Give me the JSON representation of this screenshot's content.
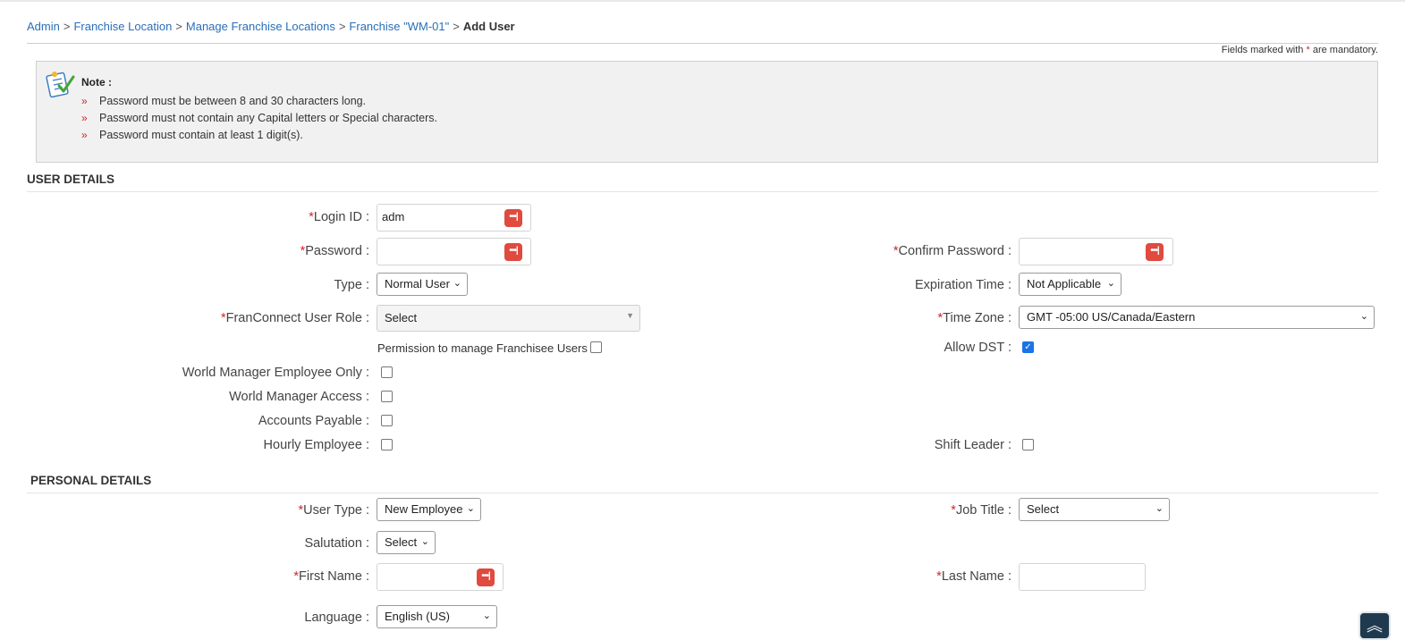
{
  "breadcrumb": {
    "items": [
      "Admin",
      "Franchise Location",
      "Manage Franchise Locations",
      "Franchise \"WM-01\""
    ],
    "current": "Add User",
    "separator": ">"
  },
  "mandatory": {
    "prefix": "Fields marked with",
    "star": "*",
    "suffix": "are mandatory."
  },
  "note": {
    "title": "Note :",
    "bullet": "»",
    "items": [
      "Password must be between 8 and 30 characters long.",
      "Password must not contain any Capital letters or Special characters.",
      "Password must contain at least 1 digit(s)."
    ]
  },
  "user_details": {
    "title": "USER DETAILS",
    "login_id": {
      "label": "Login ID :",
      "value": "adm"
    },
    "password": {
      "label": "Password :",
      "value": ""
    },
    "confirm_password": {
      "label": "Confirm Password :",
      "value": ""
    },
    "type": {
      "label": "Type :",
      "value": "Normal User"
    },
    "expiration_time": {
      "label": "Expiration Time :",
      "value": "Not Applicable"
    },
    "user_role": {
      "label": "FranConnect User Role :",
      "value": "Select"
    },
    "time_zone": {
      "label": "Time Zone :",
      "value": "GMT -05:00 US/Canada/Eastern"
    },
    "permission_label": "Permission to manage Franchisee Users",
    "allow_dst": {
      "label": "Allow DST :",
      "checked": true
    },
    "wm_employee_only": "World Manager Employee Only :",
    "wm_access": "World Manager Access :",
    "accounts_payable": "Accounts Payable :",
    "hourly_employee": "Hourly Employee :",
    "shift_leader": "Shift Leader :"
  },
  "personal_details": {
    "title": "PERSONAL DETAILS",
    "user_type": {
      "label": "User Type :",
      "value": "New Employee"
    },
    "job_title": {
      "label": "Job Title :",
      "value": "Select"
    },
    "salutation": {
      "label": "Salutation :",
      "value": "Select"
    },
    "first_name": {
      "label": "First Name :",
      "value": ""
    },
    "last_name": {
      "label": "Last Name :",
      "value": ""
    },
    "language": {
      "label": "Language :",
      "value": "English (US)"
    }
  },
  "icons": {
    "key": "password-key-icon",
    "note": "note-checklist-icon",
    "scroll_top": "scroll-to-top-icon"
  },
  "colors": {
    "link": "#2a6fb8",
    "required": "#d0262c",
    "key_icon": "#e04a3f",
    "note_bg": "#f1f1f1"
  }
}
